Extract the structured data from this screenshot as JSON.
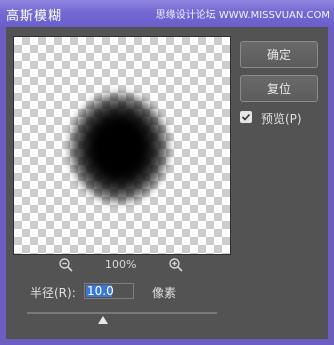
{
  "window": {
    "title": "高斯模糊",
    "watermark": "思缘设计论坛 WWW.MISSVUAN.COM"
  },
  "buttons": {
    "ok_label": "确定",
    "reset_label": "复位"
  },
  "preview": {
    "label": "预览(P)",
    "checked": true
  },
  "zoom": {
    "level": "100%"
  },
  "radius": {
    "label": "半径(R):",
    "value": "10.0",
    "unit": "像素"
  },
  "slider": {
    "fraction": 0.4
  },
  "colors": {
    "title_bar": "#7468d2",
    "dialog_bg": "#535353",
    "input_highlight": "#3b78d4"
  }
}
